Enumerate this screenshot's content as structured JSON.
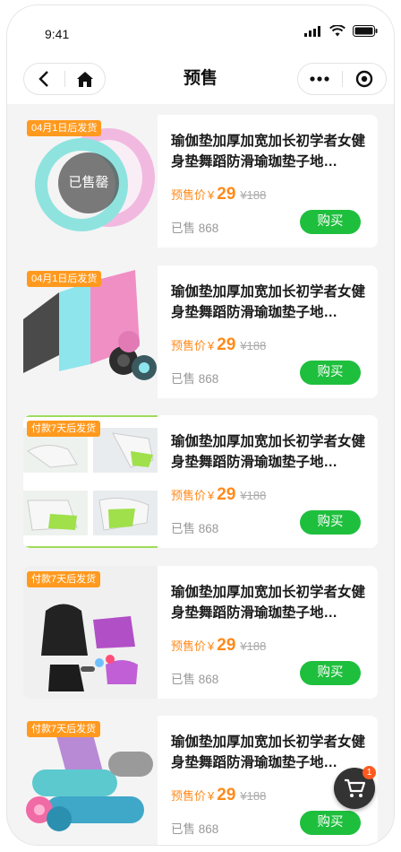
{
  "status_bar": {
    "time": "9:41"
  },
  "nav": {
    "title": "预售"
  },
  "products": [
    {
      "tag": "04月1日后发货",
      "sold_out": "已售罄",
      "name": "瑜伽垫加厚加宽加长初学者女健身垫舞蹈防滑瑜珈垫子地…",
      "price_label": "预售价",
      "currency": "¥",
      "price": "29",
      "original_price": "¥188",
      "sold": "已售 868",
      "buy": "购买"
    },
    {
      "tag": "04月1日后发货",
      "name": "瑜伽垫加厚加宽加长初学者女健身垫舞蹈防滑瑜珈垫子地…",
      "price_label": "预售价",
      "currency": "¥",
      "price": "29",
      "original_price": "¥188",
      "sold": "已售 868",
      "buy": "购买"
    },
    {
      "tag": "付款7天后发货",
      "name": "瑜伽垫加厚加宽加长初学者女健身垫舞蹈防滑瑜珈垫子地…",
      "price_label": "预售价",
      "currency": "¥",
      "price": "29",
      "original_price": "¥188",
      "sold": "已售 868",
      "buy": "购买"
    },
    {
      "tag": "付款7天后发货",
      "name": "瑜伽垫加厚加宽加长初学者女健身垫舞蹈防滑瑜珈垫子地…",
      "price_label": "预售价",
      "currency": "¥",
      "price": "29",
      "original_price": "¥188",
      "sold": "已售 868",
      "buy": "购买"
    },
    {
      "tag": "付款7天后发货",
      "name": "瑜伽垫加厚加宽加长初学者女健身垫舞蹈防滑瑜珈垫子地…",
      "price_label": "预售价",
      "currency": "¥",
      "price": "29",
      "original_price": "¥188",
      "sold": "已售 868",
      "buy": "购买"
    }
  ],
  "cart": {
    "badge": "1"
  },
  "colors": {
    "accent_green": "#1fbf3e",
    "price_orange": "#ff8a1a",
    "tag_orange": "#ff9a1f"
  }
}
